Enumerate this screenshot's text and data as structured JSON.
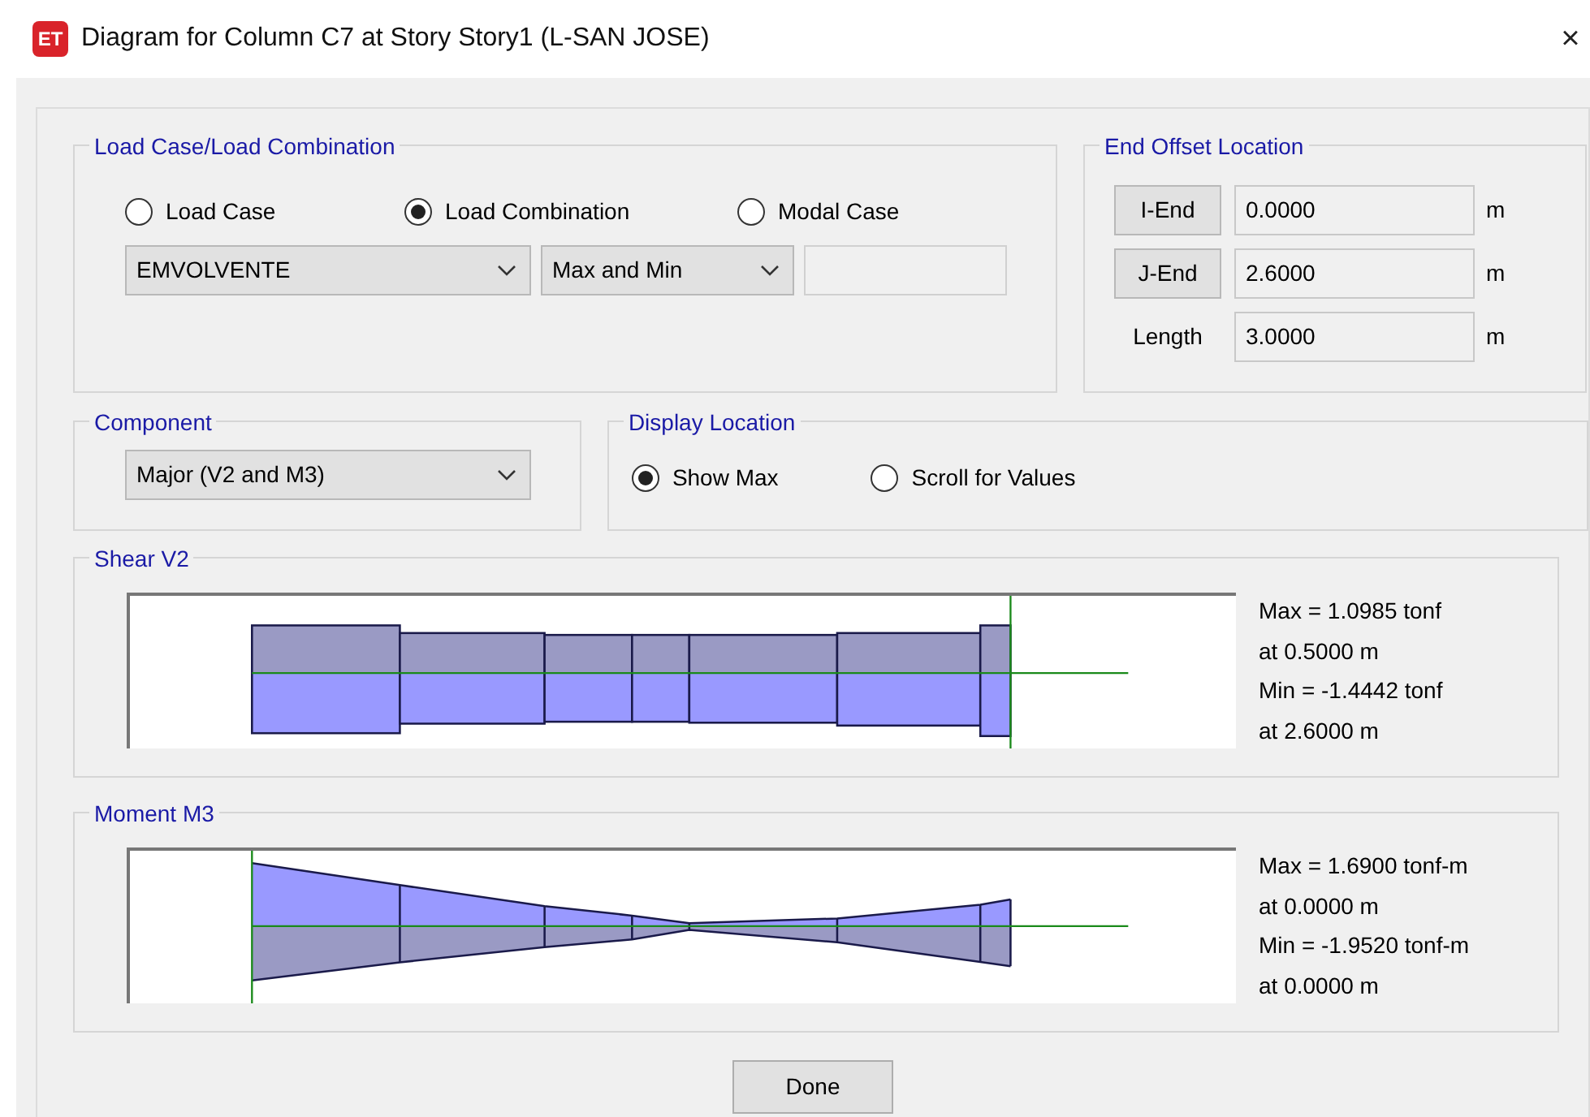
{
  "window": {
    "app_icon": "ET",
    "title": "Diagram for Column C7 at Story Story1 (L-SAN JOSE)",
    "close": "×"
  },
  "load_case_group": {
    "title": "Load Case/Load Combination",
    "options": [
      {
        "label": "Load Case",
        "selected": false
      },
      {
        "label": "Load Combination",
        "selected": true
      },
      {
        "label": "Modal Case",
        "selected": false
      }
    ],
    "case_dropdown": {
      "value": "EMVOLVENTE"
    },
    "type_dropdown": {
      "value": "Max and Min"
    }
  },
  "end_offset": {
    "title": "End Offset Location",
    "rows": [
      {
        "kind": "button",
        "label": "I-End",
        "value": "0.0000",
        "unit": "m"
      },
      {
        "kind": "button",
        "label": "J-End",
        "value": "2.6000",
        "unit": "m"
      },
      {
        "kind": "label",
        "label": "Length",
        "value": "3.0000",
        "unit": "m"
      }
    ]
  },
  "component": {
    "title": "Component",
    "dropdown": {
      "value": "Major (V2 and M3)"
    }
  },
  "display_location": {
    "title": "Display Location",
    "options": [
      {
        "label": "Show Max",
        "selected": true
      },
      {
        "label": "Scroll for Values",
        "selected": false
      }
    ]
  },
  "diagrams": [
    {
      "kind": "shear",
      "title": "Shear V2",
      "readings": [
        "Max = 1.0985 tonf",
        "at 0.5000 m",
        "Min = -1.4442 tonf",
        "at 2.6000 m"
      ]
    },
    {
      "kind": "moment",
      "title": "Moment M3",
      "readings": [
        "Max = 1.6900 tonf-m",
        "at 0.0000 m",
        "Min = -1.9520 tonf-m",
        "at 0.0000 m"
      ]
    }
  ],
  "buttons": [
    "Done"
  ]
}
